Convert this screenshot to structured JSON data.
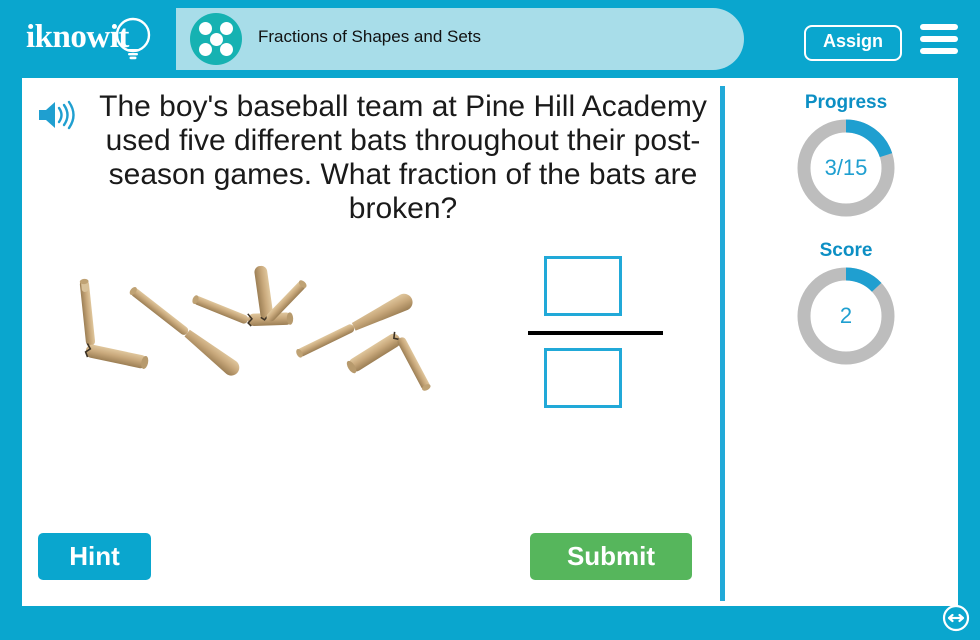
{
  "header": {
    "logo_text": "iknowit",
    "logo_icon": "lightbulb-icon",
    "topic_icon": "five-dots-circle-icon",
    "topic_title": "Fractions of Shapes and Sets",
    "assign_label": "Assign",
    "menu_icon": "hamburger-menu-icon"
  },
  "question": {
    "speaker_icon": "speaker-audio-icon",
    "text": "The boy's baseball team at Pine Hill Academy used five different bats throughout their post-season games. What fraction of the bats are broken?"
  },
  "illustration": {
    "subject": "baseball-bats",
    "total": 5,
    "broken": 3,
    "whole": 2,
    "bat_color": "#c8a87a",
    "bat_shadow": "#8d7146"
  },
  "answer": {
    "numerator_value": "",
    "denominator_value": "",
    "box_border_color": "#21a9d8",
    "bar_color": "#000000"
  },
  "actions": {
    "hint_label": "Hint",
    "hint_color": "#0aa6ce",
    "submit_label": "Submit",
    "submit_color": "#56b65c"
  },
  "sidebar": {
    "progress": {
      "label": "Progress",
      "value": "3/15",
      "current": 3,
      "total": 15,
      "percent": 20,
      "arc_color": "#1f9fd0",
      "track_color": "#bdbdbd"
    },
    "score": {
      "label": "Score",
      "value": "2",
      "current": 2,
      "total": 15,
      "percent": 13,
      "arc_color": "#1f9fd0",
      "track_color": "#bdbdbd"
    }
  },
  "footer": {
    "resize_icon": "resize-horizontal-circle-icon"
  },
  "theme": {
    "frame_color": "#0aa6ce",
    "panel_color": "#a8dde9",
    "accent_color": "#21a9d8",
    "topic_icon_color": "#16b2b2"
  }
}
